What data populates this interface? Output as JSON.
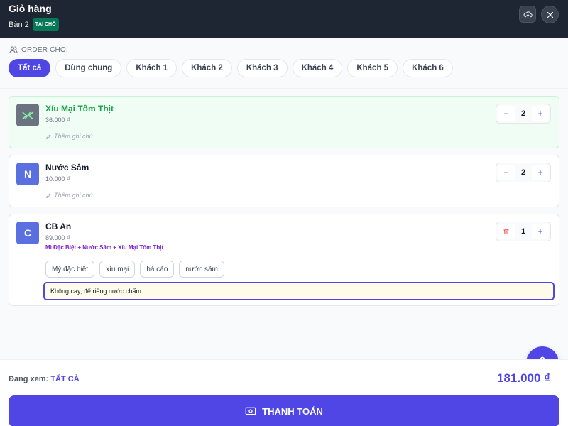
{
  "header": {
    "title": "Giỏ hàng",
    "table": "Bàn 2",
    "badge": "TẠI CHỖ",
    "upload_icon": "cloud-upload-icon",
    "close_icon": "close-icon"
  },
  "order_for": {
    "label": "ORDER CHO:",
    "tabs": [
      "Tất cả",
      "Dùng chung",
      "Khách 1",
      "Khách 2",
      "Khách 3",
      "Khách 4",
      "Khách 5",
      "Khách 6"
    ],
    "active_tab": "Tất cả"
  },
  "items": [
    {
      "name": "Xíu Mại Tôm Thịt",
      "price": "36.000 ₫",
      "quantity": "2",
      "note_placeholder": "Thêm ghi chú...",
      "served": true
    },
    {
      "initial": "N",
      "name": "Nước Sâm",
      "price": "10.000 ₫",
      "quantity": "2",
      "note_placeholder": "Thêm ghi chú..."
    },
    {
      "initial": "C",
      "name": "CB An",
      "price": "89.000 ₫",
      "quantity": "1",
      "combo_contents": "Mì Đặc Biệt + Nước Sâm + Xíu Mại Tôm Thịt",
      "quick_notes": [
        "Mỳ đặc biệt",
        "xíu mại",
        "há cảo",
        "nước sâm"
      ],
      "note_value": "Không cay, để riêng nước chấm"
    }
  ],
  "footer": {
    "viewing_label": "Đang xem:",
    "viewing_value": "TẤT CẢ",
    "total": "181.000 ₫",
    "checkout_label": "THANH TOÁN"
  },
  "colors": {
    "accent": "#4f46e5",
    "header_bg": "#1f2633",
    "served_bg": "#f0fdf4",
    "combo_text": "#7e22ce"
  }
}
